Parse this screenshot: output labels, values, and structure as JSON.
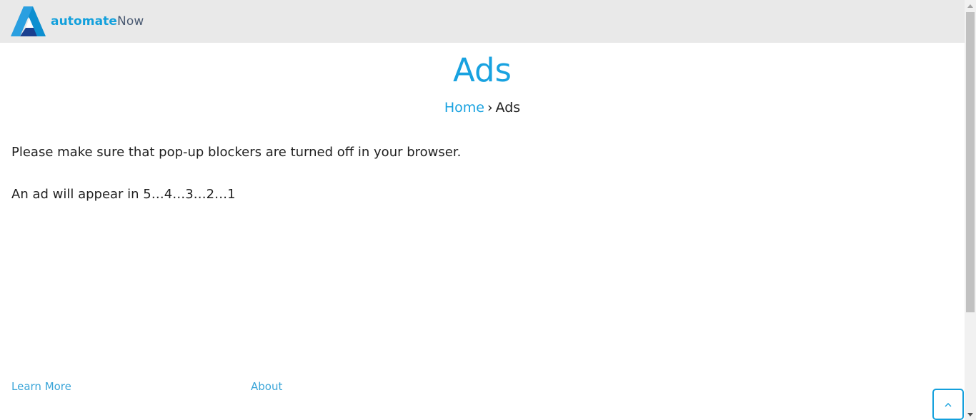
{
  "brand": {
    "name_bold": "automate",
    "name_regular": "Now",
    "primary_color": "#12a0dc",
    "secondary_color": "#4a5a72",
    "logo_icon": "automatenow-logo-icon"
  },
  "page": {
    "title": "Ads",
    "title_color": "#18a2e0"
  },
  "breadcrumb": {
    "home_label": "Home",
    "separator": "›",
    "current_label": "Ads"
  },
  "content": {
    "notice": "Please make sure that pop-up blockers are turned off in your browser.",
    "countdown": "An ad will appear in 5…4…3…2…1"
  },
  "footer": {
    "links": [
      {
        "label": "Learn More"
      },
      {
        "label": "About"
      }
    ]
  },
  "controls": {
    "back_to_top_icon": "chevron-up-icon",
    "scroll_up_icon": "triangle-up-icon",
    "scroll_down_icon": "triangle-down-icon"
  }
}
